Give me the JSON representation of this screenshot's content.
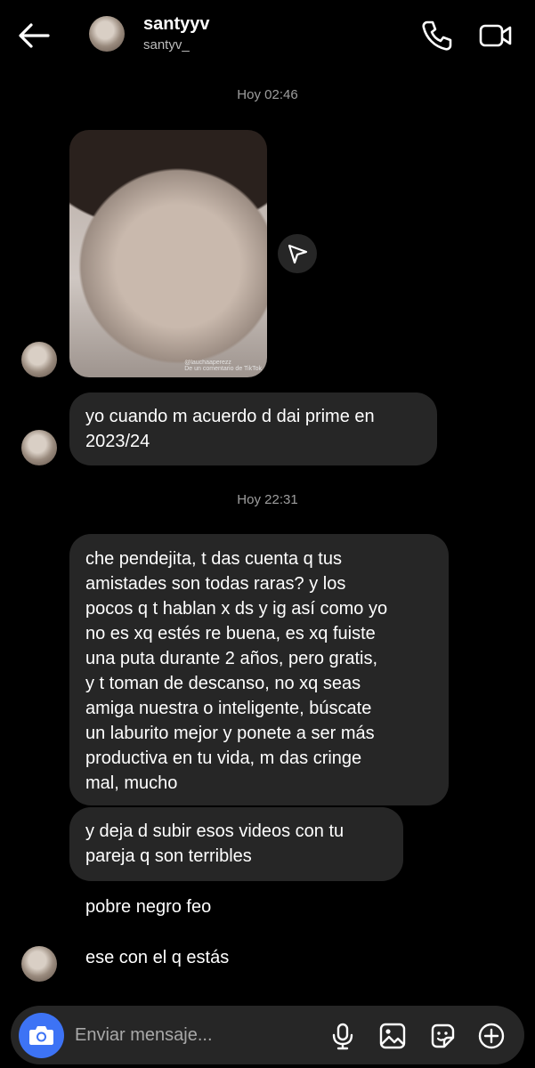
{
  "header": {
    "name": "santyyv",
    "username": "santyv_",
    "icons": [
      "back-arrow-icon",
      "phone-icon",
      "video-call-icon"
    ]
  },
  "thread": {
    "timestamp_1": "Hoy 02:46",
    "media_credit_1": "@lauchaaperezz",
    "media_credit_2": "De un comentario de TikTok",
    "message_1": "yo cuando m acuerdo d dai prime en\n2023/24",
    "timestamp_2": "Hoy 22:31",
    "message_2": "che pendejita, t das cuenta q tus\namistades son todas raras? y los\npocos q t hablan x ds y ig así como yo\nno es xq estés re buena, es xq fuiste\nuna puta durante 2 años, pero gratis,\ny t toman de descanso, no xq seas\namiga nuestra o inteligente, búscate\nun laburito mejor y ponete a ser más\nproductiva en tu vida, m das cringe\nmal, mucho",
    "message_3": "y deja d subir esos videos con tu\npareja q son terribles",
    "message_4": "pobre negro feo",
    "message_5": "ese con el q estás"
  },
  "composer": {
    "placeholder": "Enviar mensaje...",
    "icons": [
      "camera-icon",
      "microphone-icon",
      "gallery-icon",
      "sticker-icon",
      "add-icon"
    ]
  },
  "colors": {
    "background": "#000000",
    "bubble": "#262626",
    "camera_button": "#3d73f5"
  }
}
